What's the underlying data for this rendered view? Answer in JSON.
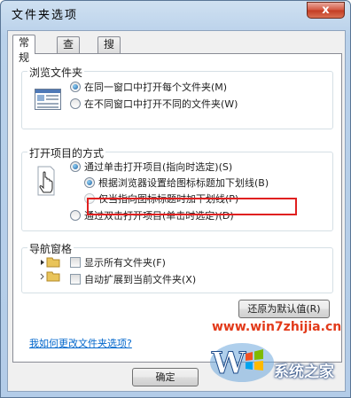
{
  "window": {
    "title": "文件夹选项",
    "close_glyph": "x"
  },
  "tabs": [
    {
      "label": "常规"
    },
    {
      "label": "查看"
    },
    {
      "label": "搜索"
    }
  ],
  "browse_group": {
    "title": "浏览文件夹",
    "icon": "window-icon",
    "options": [
      {
        "label": "在同一窗口中打开每个文件夹(M)",
        "selected": true
      },
      {
        "label": "在不同窗口中打开不同的文件夹(W)",
        "selected": false
      }
    ]
  },
  "open_group": {
    "title": "打开项目的方式",
    "icon": "hand-cursor-icon",
    "options": [
      {
        "label": "通过单击打开项目(指向时选定)(S)",
        "selected": true
      },
      {
        "label": "根据浏览器设置给图标标题加下划线(B)",
        "selected": true
      },
      {
        "label": "仅当指向图标标题时加下划线(P)",
        "selected": false
      },
      {
        "label": "通过双击打开项目(单击时选定)(D)",
        "selected": false
      }
    ]
  },
  "nav_group": {
    "title": "导航窗格",
    "options": [
      {
        "label": "显示所有文件夹(F)",
        "checked": false
      },
      {
        "label": "自动扩展到当前文件夹(X)",
        "checked": false
      }
    ]
  },
  "restore_button": "还原为默认值(R)",
  "help_link": "我如何更改文件夹选项?",
  "ok_button": "确定",
  "watermark": {
    "url": "www.win7zhijia.cn",
    "brand": "系统之家"
  }
}
